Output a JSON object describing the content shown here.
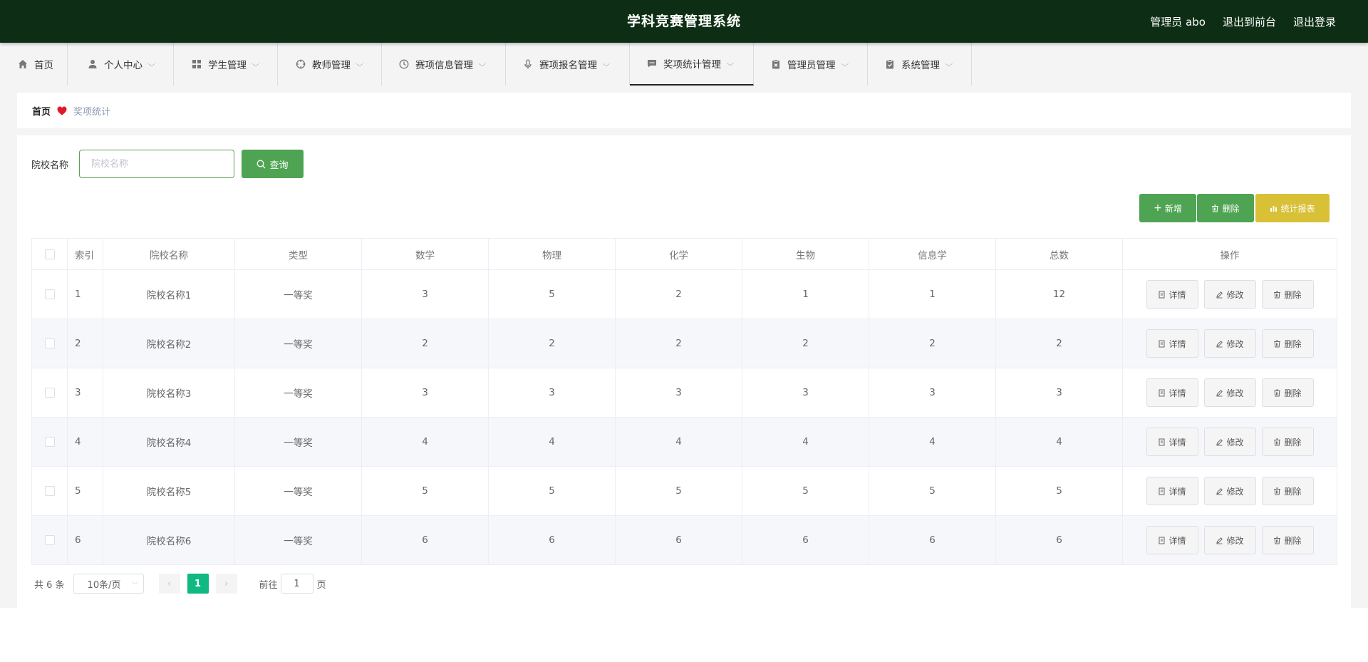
{
  "header": {
    "title": "学科竞赛管理系统",
    "admin_label": "管理员 abo",
    "front_link": "退出到前台",
    "logout_link": "退出登录"
  },
  "nav": {
    "items": [
      {
        "label": "首页",
        "icon": "home-icon"
      },
      {
        "label": "个人中心",
        "icon": "user-icon"
      },
      {
        "label": "学生管理",
        "icon": "grid-icon"
      },
      {
        "label": "教师管理",
        "icon": "target-icon"
      },
      {
        "label": "赛项信息管理",
        "icon": "clock-icon"
      },
      {
        "label": "赛项报名管理",
        "icon": "microphone-icon"
      },
      {
        "label": "奖项统计管理",
        "icon": "chat-icon"
      },
      {
        "label": "管理员管理",
        "icon": "clipboard-x-icon"
      },
      {
        "label": "系统管理",
        "icon": "clipboard-check-icon"
      }
    ],
    "active_index": 6
  },
  "breadcrumb": {
    "home": "首页",
    "current": "奖项统计"
  },
  "search": {
    "label": "院校名称",
    "placeholder": "院校名称",
    "value": "",
    "button": "查询"
  },
  "actions": {
    "add": "新增",
    "delete": "删除",
    "report": "统计报表"
  },
  "table": {
    "columns": [
      "",
      "索引",
      "院校名称",
      "类型",
      "数学",
      "物理",
      "化学",
      "生物",
      "信息学",
      "总数",
      "操作"
    ],
    "rows": [
      {
        "idx": "1",
        "school": "院校名称1",
        "type": "一等奖",
        "math": "3",
        "physics": "5",
        "chem": "2",
        "bio": "1",
        "info": "1",
        "total": "12"
      },
      {
        "idx": "2",
        "school": "院校名称2",
        "type": "一等奖",
        "math": "2",
        "physics": "2",
        "chem": "2",
        "bio": "2",
        "info": "2",
        "total": "2"
      },
      {
        "idx": "3",
        "school": "院校名称3",
        "type": "一等奖",
        "math": "3",
        "physics": "3",
        "chem": "3",
        "bio": "3",
        "info": "3",
        "total": "3"
      },
      {
        "idx": "4",
        "school": "院校名称4",
        "type": "一等奖",
        "math": "4",
        "physics": "4",
        "chem": "4",
        "bio": "4",
        "info": "4",
        "total": "4"
      },
      {
        "idx": "5",
        "school": "院校名称5",
        "type": "一等奖",
        "math": "5",
        "physics": "5",
        "chem": "5",
        "bio": "5",
        "info": "5",
        "total": "5"
      },
      {
        "idx": "6",
        "school": "院校名称6",
        "type": "一等奖",
        "math": "6",
        "physics": "6",
        "chem": "6",
        "bio": "6",
        "info": "6",
        "total": "6"
      }
    ],
    "row_actions": {
      "detail": "详情",
      "edit": "修改",
      "delete": "删除"
    }
  },
  "pagination": {
    "total": "共 6 条",
    "page_size": "10条/页",
    "current_page": "1",
    "goto_label": "前往",
    "goto_value": "1",
    "page_suffix": "页"
  },
  "colors": {
    "header_bg": "#0d2e14",
    "primary_green": "#4fa453",
    "report_yellow": "#d8c037",
    "page_active": "#10b981",
    "breadcrumb_heart": "#e0192b"
  }
}
